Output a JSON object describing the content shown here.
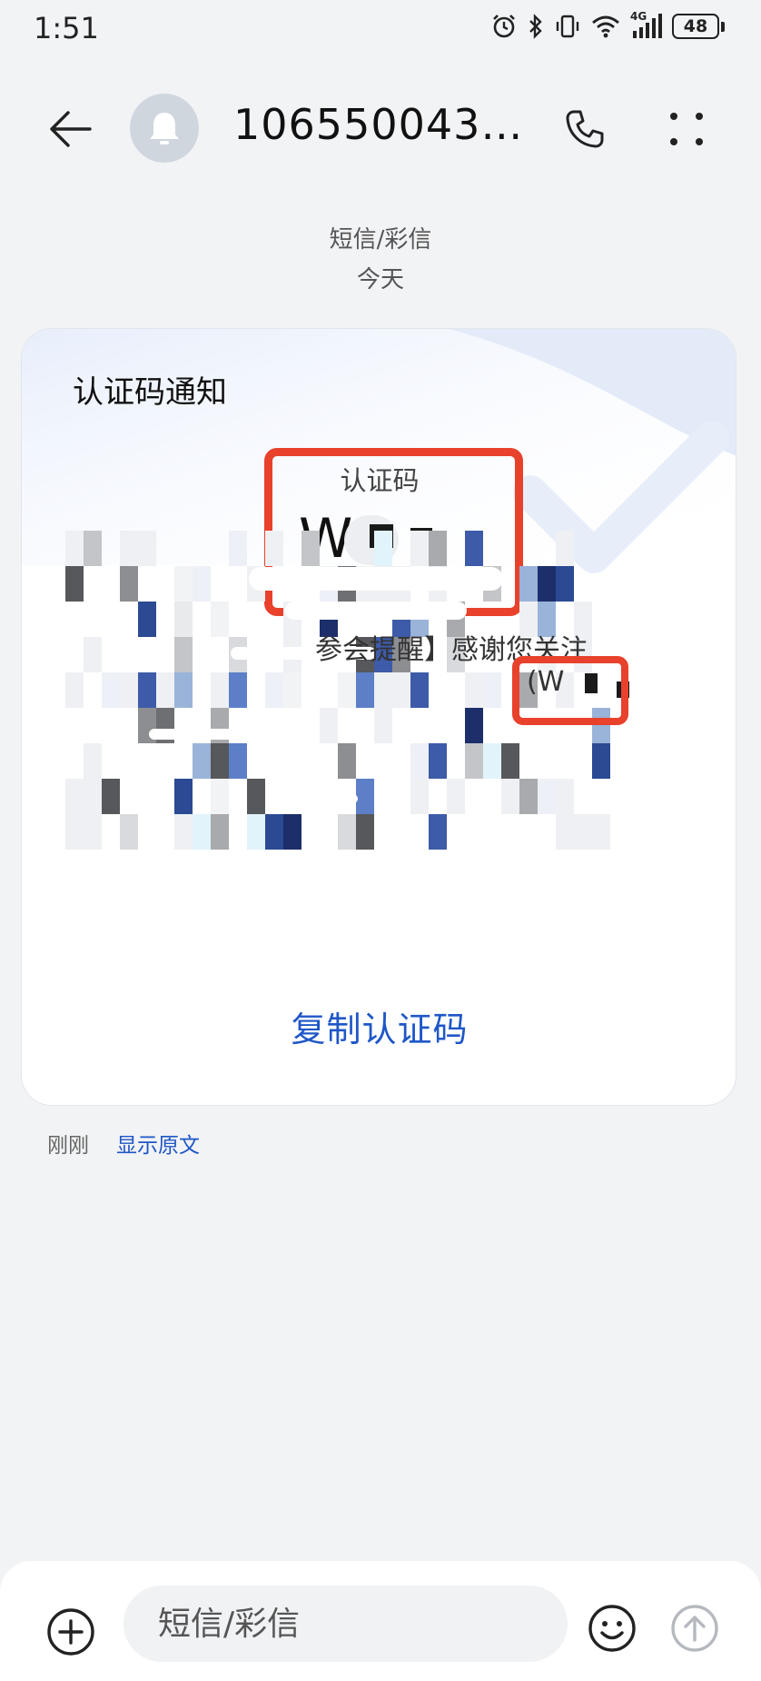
{
  "status_bar": {
    "time": "1:51",
    "network_label": "4G",
    "battery_level": "48",
    "icons": [
      "alarm-icon",
      "bluetooth-icon",
      "vibrate-icon",
      "wifi-icon",
      "cellular-signal-icon",
      "battery-icon"
    ]
  },
  "header": {
    "contact": "1065500430...",
    "icons": [
      "back-arrow-icon",
      "bell-icon",
      "phone-icon",
      "more-dots-icon"
    ]
  },
  "conversation": {
    "message_type": "短信/彩信",
    "date": "今天"
  },
  "card": {
    "title": "认证码通知",
    "code_label": "认证码",
    "code_prefix": "W",
    "body_visible": "参会提醒】感谢您关注",
    "inline_code_prefix": "(W",
    "copy_label": "复制认证码",
    "highlight_color": "#e8412c",
    "accent_color": "#1f57c7"
  },
  "message_footer": {
    "time": "刚刚",
    "show_original": "显示原文"
  },
  "composer": {
    "placeholder": "短信/彩信",
    "icons": [
      "plus-circle-icon",
      "emoji-icon",
      "send-arrow-icon"
    ]
  }
}
